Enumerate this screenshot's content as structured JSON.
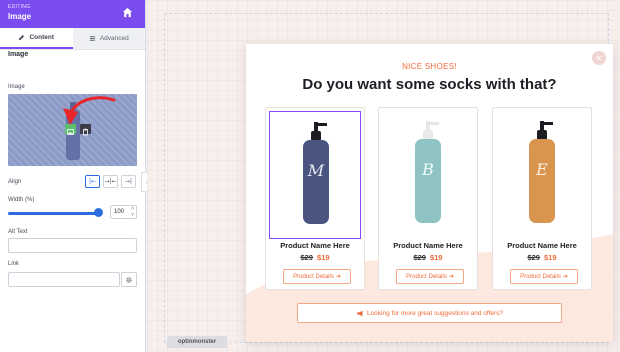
{
  "sidebar": {
    "header": {
      "editing_label": "EDITING",
      "title": "Image"
    },
    "tabs": [
      {
        "label": "Content"
      },
      {
        "label": "Advanced"
      }
    ],
    "section_title": "Image",
    "image_label": "Image",
    "align_label": "Align",
    "width_label": "Width (%)",
    "width_value": "100",
    "width_slider_percent": 100,
    "alt_text_label": "Alt Text",
    "alt_text_value": "",
    "link_label": "Link",
    "link_value": ""
  },
  "popup": {
    "eyebrow": "NICE SHOES!",
    "headline": "Do you want some socks with that?",
    "products": [
      {
        "name": "Product Name Here",
        "old_price": "$29",
        "new_price": "$19",
        "button": "Product Details",
        "bottle_color": "#4a5480",
        "letter": "M"
      },
      {
        "name": "Product Name Here",
        "old_price": "$29",
        "new_price": "$19",
        "button": "Product Details",
        "bottle_color": "#8fc3c3",
        "letter": "B"
      },
      {
        "name": "Product Name Here",
        "old_price": "$29",
        "new_price": "$19",
        "button": "Product Details",
        "bottle_color": "#d9944e",
        "letter": "E"
      }
    ],
    "cta": "Looking for more great suggestions and offers?"
  },
  "branding": {
    "logo_text": "optinmonster"
  },
  "colors": {
    "accent": "#7b4cf0",
    "orange": "#f26b3a",
    "blue": "#2b6cdf"
  }
}
